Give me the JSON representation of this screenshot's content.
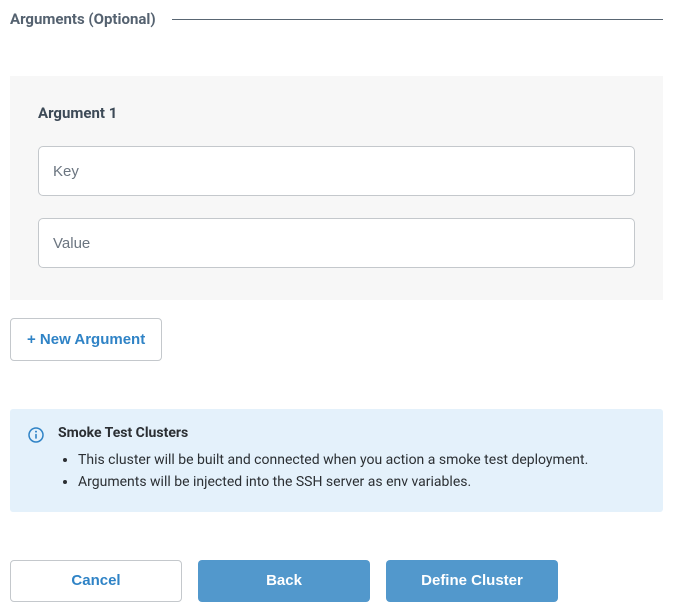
{
  "section": {
    "title": "Arguments (Optional)"
  },
  "argument": {
    "label": "Argument 1",
    "key_placeholder": "Key",
    "value_placeholder": "Value"
  },
  "new_argument_btn": "+ New Argument",
  "info": {
    "title": "Smoke Test Clusters",
    "bullets": [
      "This cluster will be built and connected when you action a smoke test deployment.",
      "Arguments will be injected into the SSH server as env variables."
    ]
  },
  "actions": {
    "cancel": "Cancel",
    "back": "Back",
    "define": "Define Cluster"
  },
  "colors": {
    "accent": "#5298cc",
    "link": "#2f83c6",
    "info_bg": "#e4f1fb",
    "card_bg": "#f7f7f7"
  }
}
